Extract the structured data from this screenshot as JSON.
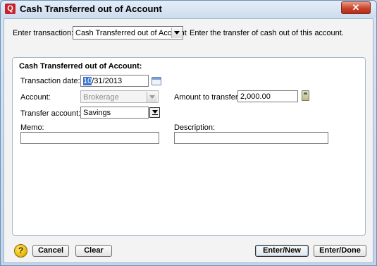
{
  "window": {
    "title": "Cash Transferred out of Account",
    "app_icon_glyph": "Q",
    "close_glyph": "✕"
  },
  "top": {
    "enter_transaction_label": "Enter transaction:",
    "transaction_type_value": "Cash Transferred out of Account",
    "hint": "Enter the transfer of cash out of this account."
  },
  "panel": {
    "title": "Cash Transferred out of Account:",
    "transaction_date_label": "Transaction date:",
    "transaction_date_selected": "10",
    "transaction_date_rest": "/31/2013",
    "account_label": "Account:",
    "account_value": "Brokerage",
    "amount_label": "Amount to transfer:",
    "amount_value": "2,000.00",
    "transfer_account_label": "Transfer account:",
    "transfer_account_value": "Savings",
    "memo_label": "Memo:",
    "memo_value": "",
    "description_label": "Description:",
    "description_value": ""
  },
  "buttons": {
    "help_glyph": "?",
    "cancel": "Cancel",
    "clear": "Clear",
    "enter_new": "Enter/New",
    "enter_done": "Enter/Done"
  },
  "icons": {
    "calendar": "calendar-icon",
    "calculator": "calculator-icon",
    "lookup": "lookup-icon",
    "help": "help-icon"
  },
  "colors": {
    "selection": "#3a74d1",
    "close_button": "#c8432a",
    "app_icon": "#c8222c"
  }
}
